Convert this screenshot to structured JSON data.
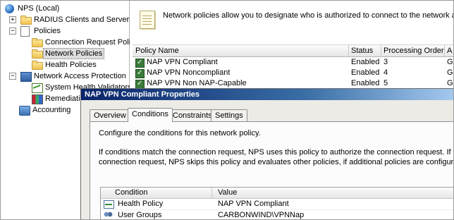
{
  "tree": {
    "root": "NPS (Local)",
    "items": [
      {
        "label": "RADIUS Clients and Servers",
        "expander": "+"
      },
      {
        "label": "Policies",
        "expander": "−"
      },
      {
        "label": "Connection Request Polici"
      },
      {
        "label": "Network Policies",
        "selected": true
      },
      {
        "label": "Health Policies"
      },
      {
        "label": "Network Access Protection",
        "expander": "−"
      },
      {
        "label": "System Health Validators"
      },
      {
        "label": "Remediation"
      },
      {
        "label": "Accounting"
      }
    ]
  },
  "info": {
    "text": "Network policies allow you to designate who is authorized to connect to the network and the c"
  },
  "policy_table": {
    "columns": [
      "Policy Name",
      "Status",
      "Processing Order",
      "A"
    ],
    "rows": [
      {
        "name": "NAP VPN Compliant",
        "status": "Enabled",
        "order": "3",
        "extra": "G"
      },
      {
        "name": "NAP VPN Noncompliant",
        "status": "Enabled",
        "order": "4",
        "extra": "G"
      },
      {
        "name": "NAP VPN Non NAP-Capable",
        "status": "Enabled",
        "order": "5",
        "extra": "G"
      }
    ]
  },
  "dialog": {
    "title": "NAP VPN Compliant Properties",
    "tabs": [
      "Overview",
      "Conditions",
      "Constraints",
      "Settings"
    ],
    "active_tab": "Conditions",
    "desc1": "Configure the conditions for this network policy.",
    "desc2": "If conditions match the connection request, NPS uses this policy to authorize the connection request. If conditions d",
    "desc3": "connection request, NPS skips this policy and evaluates other policies, if additional policies are configured.",
    "conditions": {
      "columns": [
        "Condition",
        "Value"
      ],
      "rows": [
        {
          "condition": "Health Policy",
          "value": "NAP VPN Compliant",
          "icon": "health-policy-icon"
        },
        {
          "condition": "User Groups",
          "value": "CARBONWIND\\VPNNap",
          "icon": "user-groups-icon"
        }
      ]
    }
  },
  "colors": {
    "title_bar_start": "#0a246a",
    "title_bar_end": "#a6caf0",
    "dialog_bg": "#ecebe6",
    "selection": "#dedede"
  }
}
